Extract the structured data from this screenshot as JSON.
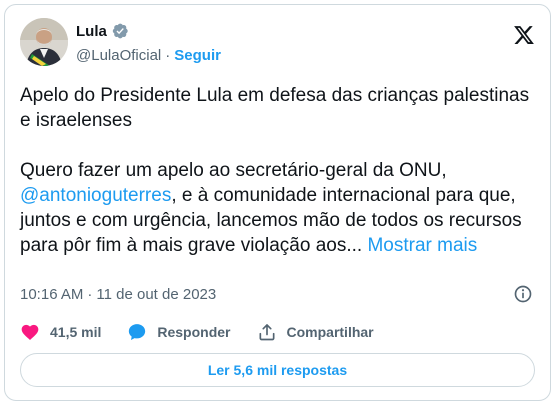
{
  "author": {
    "name": "Lula",
    "handle": "@LulaOficial",
    "separator": "·",
    "follow_label": "Seguir"
  },
  "tweet": {
    "title_line": "Apelo do Presidente Lula em defesa das crianças palestinas e israelenses",
    "para_start": "Quero fazer um apelo ao secretário-geral da ONU, ",
    "mention": "@antonioguterres",
    "para_end": ", e à comunidade internacional para que, juntos e com urgência, lancemos mão de todos os recursos para pôr fim à mais grave violação aos... ",
    "show_more": "Mostrar mais"
  },
  "meta": {
    "time": "10:16 AM",
    "separator": "·",
    "date": "11 de out de 2023"
  },
  "actions": {
    "likes": "41,5 mil",
    "reply_label": "Responder",
    "share_label": "Compartilhar"
  },
  "replies_button": "Ler 5,6 mil respostas",
  "icons": {
    "verified": "verified-badge-icon",
    "x_logo": "x-logo-icon",
    "info": "info-icon",
    "like": "heart-icon",
    "reply": "speech-bubble-icon",
    "share": "share-upload-icon"
  },
  "colors": {
    "accent": "#1d9bf0",
    "like": "#f91880",
    "text": "#0f1419",
    "muted": "#536471",
    "border": "#cfd9de"
  }
}
